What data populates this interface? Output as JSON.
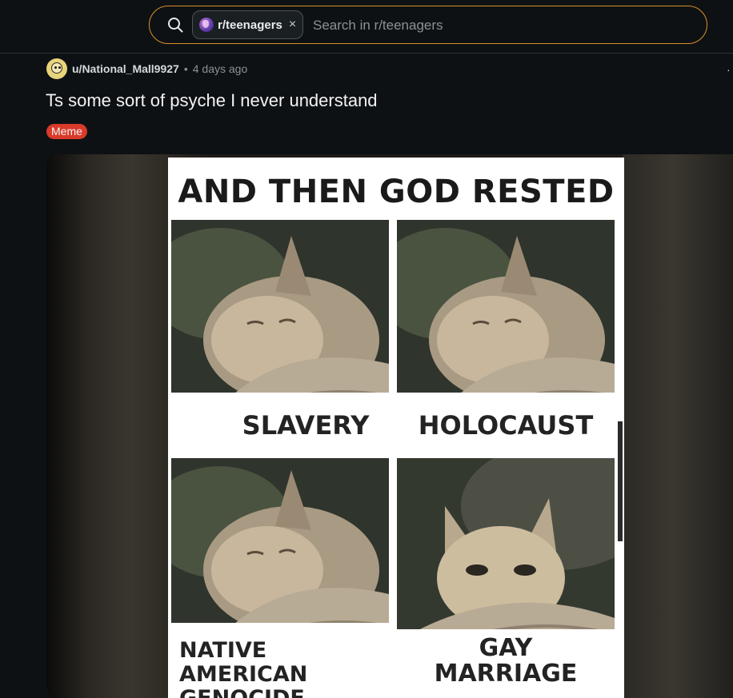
{
  "search": {
    "community_chip": "r/teenagers",
    "placeholder": "Search in r/teenagers",
    "close_symbol": "×"
  },
  "post": {
    "author": "u/National_Mall9927",
    "separator": "•",
    "time": "4 days ago",
    "title": "Ts some sort of psyche I never understand",
    "flair": "Meme",
    "flair_color": "#d93a2a",
    "more_symbol": "·"
  },
  "meme": {
    "heading": "AND THEN GOD RESTED",
    "panels": [
      {
        "caption": "SLAVERY"
      },
      {
        "caption": "HOLOCAUST"
      },
      {
        "caption": "NATIVE AMERICAN GENOCIDE"
      },
      {
        "caption": "GAY MARRIAGE"
      }
    ]
  },
  "colors": {
    "background": "#0e1113",
    "search_border": "#d9902a",
    "text_primary": "#f2f3f5",
    "text_secondary": "#8a9195"
  },
  "icons": {
    "search": "search-icon",
    "community": "community-avatar-icon",
    "close": "close-icon",
    "user": "user-avatar-icon",
    "more": "more-options-icon"
  }
}
